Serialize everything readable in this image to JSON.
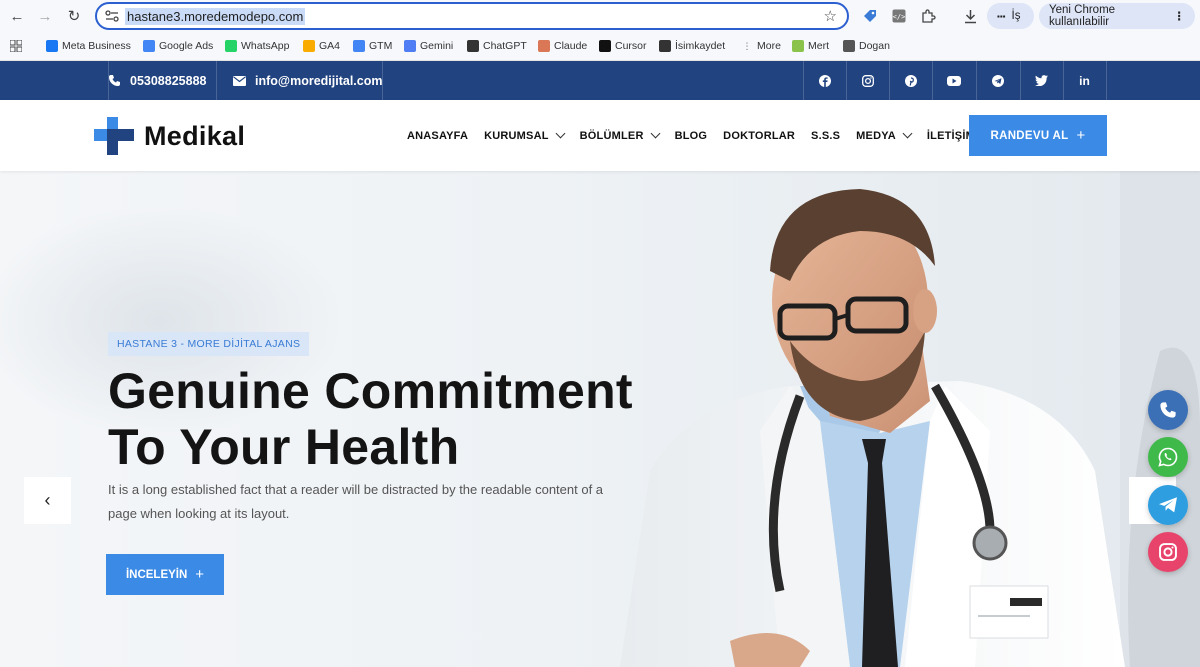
{
  "browser": {
    "url": "hastane3.moredemodepo.com",
    "profile_label": "İş",
    "update_label": "Yeni Chrome kullanılabilir",
    "bookmarks": [
      {
        "label": "Meta Business",
        "icon": "meta-icon",
        "color": "#1877f2"
      },
      {
        "label": "Google Ads",
        "icon": "google-icon",
        "color": "#4285f4"
      },
      {
        "label": "WhatsApp",
        "icon": "whatsapp-icon",
        "color": "#25d366"
      },
      {
        "label": "GA4",
        "icon": "analytics-icon",
        "color": "#f9ab00"
      },
      {
        "label": "GTM",
        "icon": "gtm-icon",
        "color": "#4285f4"
      },
      {
        "label": "Gemini",
        "icon": "gemini-icon",
        "color": "#4f7df3"
      },
      {
        "label": "ChatGPT",
        "icon": "chatgpt-icon",
        "color": "#333333"
      },
      {
        "label": "Claude",
        "icon": "claude-icon",
        "color": "#d97757"
      },
      {
        "label": "Cursor",
        "icon": "cursor-icon",
        "color": "#111111"
      },
      {
        "label": "İsimkaydet",
        "icon": "isimkaydet-icon",
        "color": "#333333"
      },
      {
        "label": "More",
        "icon": "more-icon",
        "color": "#888888"
      },
      {
        "label": "Mert",
        "icon": "code-icon",
        "color": "#8bc34a"
      },
      {
        "label": "Dogan",
        "icon": "globe-icon",
        "color": "#555555"
      }
    ]
  },
  "topbar": {
    "phone": "05308825888",
    "email": "info@moredijital.com",
    "socials": [
      "facebook-icon",
      "instagram-icon",
      "pinterest-icon",
      "youtube-icon",
      "telegram-icon",
      "twitter-icon",
      "linkedin-icon"
    ]
  },
  "header": {
    "logo_text": "Medikal",
    "nav": [
      {
        "label": "ANASAYFA",
        "dropdown": false
      },
      {
        "label": "KURUMSAL",
        "dropdown": true
      },
      {
        "label": "BÖLÜMLER",
        "dropdown": true
      },
      {
        "label": "BLOG",
        "dropdown": false
      },
      {
        "label": "DOKTORLAR",
        "dropdown": false
      },
      {
        "label": "S.S.S",
        "dropdown": false
      },
      {
        "label": "MEDYA",
        "dropdown": true
      },
      {
        "label": "İLETİŞİM",
        "dropdown": false
      }
    ],
    "cta_label": "RANDEVU AL",
    "brand_color": "#21437f",
    "accent_color": "#3a8ae6"
  },
  "hero": {
    "tag": "HASTANE 3 - MORE DİJİTAL AJANS",
    "title_line1": "Genuine Commitment",
    "title_line2": "To Your Health",
    "description": "It is a long established fact that a reader will be distracted by the readable content of a page when looking at its layout.",
    "button_label": "İNCELEYİN"
  },
  "floating": [
    {
      "name": "phone-float-button",
      "icon": "phone-icon",
      "color": "#3b6fb6"
    },
    {
      "name": "whatsapp-float-button",
      "icon": "whatsapp-icon",
      "color": "#3fb94a"
    },
    {
      "name": "telegram-float-button",
      "icon": "telegram-icon",
      "color": "#2f9ee0"
    },
    {
      "name": "instagram-float-button",
      "icon": "instagram-icon",
      "color": "#e8436a"
    }
  ]
}
